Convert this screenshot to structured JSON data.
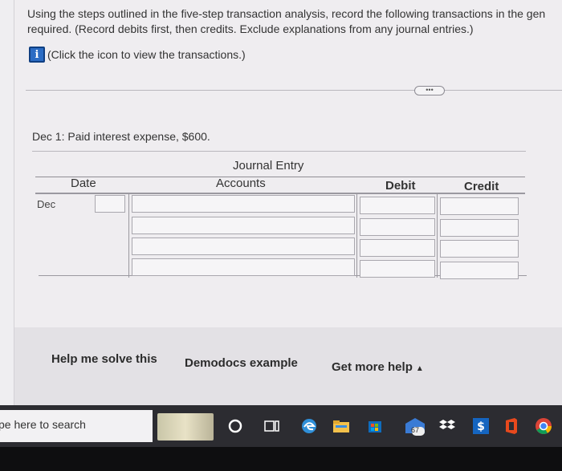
{
  "instructions": {
    "line1": "Using the steps outlined in the five-step transaction analysis, record the following transactions in the gen",
    "line2": "required. (Record debits first, then credits. Exclude explanations from any journal entries.)",
    "info_text": "(Click the icon to view the transactions.)"
  },
  "more_button": "•••",
  "question": "Dec 1: Paid interest expense, $600.",
  "journal": {
    "title": "Journal Entry",
    "headers": {
      "date": "Date",
      "accounts": "Accounts",
      "debit": "Debit",
      "credit": "Credit"
    },
    "date_month": "Dec",
    "rows": [
      {
        "day": "",
        "account": "",
        "debit": "",
        "credit": ""
      },
      {
        "account": "",
        "debit": "",
        "credit": ""
      },
      {
        "account": "",
        "debit": "",
        "credit": ""
      },
      {
        "account": "",
        "debit": "",
        "credit": ""
      }
    ]
  },
  "help": {
    "solve": "Help me solve this",
    "example": "Demodocs example",
    "more": "Get more help",
    "more_caret": "▲"
  },
  "taskbar": {
    "search_placeholder": "pe here to search",
    "badge_count": "67"
  },
  "colors": {
    "info_icon": "#2b6cc4",
    "taskbar": "#2c2c31"
  }
}
